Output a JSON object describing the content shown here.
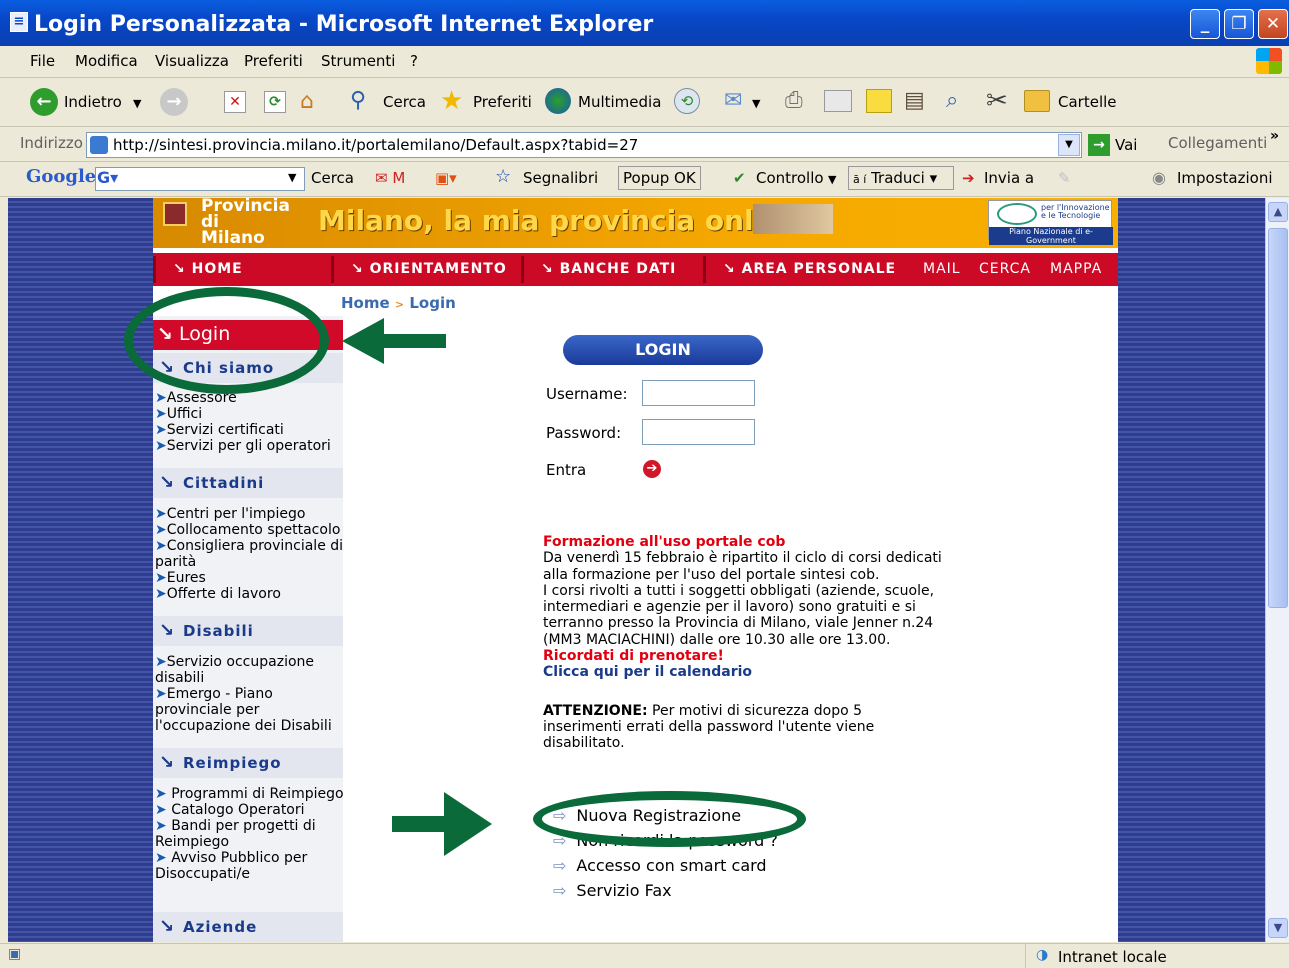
{
  "window": {
    "title": "Login Personalizzata - Microsoft Internet Explorer"
  },
  "menubar": {
    "items": [
      "File",
      "Modifica",
      "Visualizza",
      "Preferiti",
      "Strumenti",
      "?"
    ]
  },
  "toolbar": {
    "back": "Indietro",
    "search": "Cerca",
    "favorites": "Preferiti",
    "media": "Multimedia",
    "folders": "Cartelle"
  },
  "addressbar": {
    "label": "Indirizzo",
    "url": "http://sintesi.provincia.milano.it/portalemilano/Default.aspx?tabid=27",
    "go": "Vai",
    "links": "Collegamenti"
  },
  "googlebar": {
    "logo": "Google",
    "search": "Cerca",
    "bookmarks": "Segnalibri",
    "popup": "Popup OK",
    "check": "Controllo",
    "translate": "Traduci",
    "send": "Invia a",
    "settings": "Impostazioni"
  },
  "site": {
    "banner_logo": "Provincia di Milano",
    "banner_title": "Milano, la mia provincia online",
    "banner_partner": "Piano Nazionale di e-Government",
    "nav": [
      "HOME",
      "ORIENTAMENTO",
      "BANCHE DATI",
      "AREA PERSONALE"
    ],
    "nav_links": [
      "MAIL",
      "CERCA",
      "MAPPA"
    ],
    "breadcrumb": {
      "home": "Home",
      "sep": ">",
      "current": "Login"
    }
  },
  "sidebar": {
    "login": "Login",
    "sections": [
      {
        "title": "Chi siamo",
        "links": [
          "Assessore",
          "Uffici",
          "Servizi certificati",
          "Servizi per gli operatori"
        ]
      },
      {
        "title": "Cittadini",
        "links": [
          "Centri per l'impiego",
          "Collocamento spettacolo",
          "Consigliera provinciale di parità",
          "Eures",
          "Offerte di lavoro"
        ]
      },
      {
        "title": "Disabili",
        "links": [
          "Servizio occupazione disabili",
          "Emergo - Piano provinciale per l'occupazione dei Disabili"
        ]
      },
      {
        "title": "Reimpiego",
        "links": [
          "Programmi di Reimpiego",
          "Catalogo Operatori",
          "Bandi per progetti di Reimpiego",
          "Avviso Pubblico per Disoccupati/e"
        ]
      },
      {
        "title": "Aziende",
        "links": []
      }
    ]
  },
  "login": {
    "heading": "LOGIN",
    "username_label": "Username:",
    "password_label": "Password:",
    "username_value": "",
    "password_value": "",
    "submit_label": "Entra"
  },
  "news": {
    "title": "Formazione all'uso portale cob",
    "body1": "Da venerdì 15 febbraio è ripartito il ciclo di corsi dedicati alla formazione per l'uso del portale sintesi cob.",
    "body2": "I corsi rivolti a tutti i soggetti obbligati (aziende, scuole, intermediari e agenzie per il lavoro) sono gratuiti e si terranno presso la Provincia di Milano, viale Jenner n.24 (MM3 MACIACHINI) dalle ore 10.30 alle ore 13.00.",
    "reminder": "Ricordati di prenotare!",
    "calendar_link": "Clicca qui per il calendario",
    "warning_label": "ATTENZIONE:",
    "warning_text": "Per motivi di sicurezza dopo 5 inserimenti errati della password l'utente viene disabilitato."
  },
  "links": [
    "Nuova Registrazione",
    "Non ricordi la password ?",
    "Accesso con smart card",
    "Servizio Fax"
  ],
  "statusbar": {
    "zone": "Intranet locale"
  },
  "colors": {
    "nav_red": "#cc0a25",
    "annotation_green": "#0a6a3a",
    "banner_orange": "#f5a800",
    "link_blue": "#1a3a8a"
  }
}
